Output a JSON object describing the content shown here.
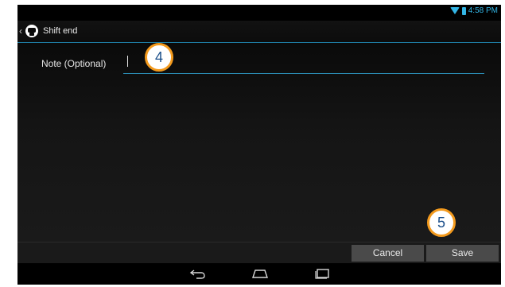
{
  "status_bar": {
    "time": "4:58 PM",
    "icons": [
      "wifi-icon",
      "battery-icon"
    ],
    "accent_color": "#33b5e5"
  },
  "action_bar": {
    "title": "Shift end",
    "icons": [
      "up-icon",
      "app-icon"
    ]
  },
  "form": {
    "note_label": "Note (Optional)",
    "note_value": ""
  },
  "callouts": {
    "step_4": "4",
    "step_5": "5",
    "border_color": "#f39a1d",
    "text_color": "#1b4f8a"
  },
  "buttons": {
    "cancel_label": "Cancel",
    "save_label": "Save"
  },
  "navigation": {
    "icons": [
      "back-icon",
      "home-icon",
      "recent-apps-icon"
    ]
  }
}
